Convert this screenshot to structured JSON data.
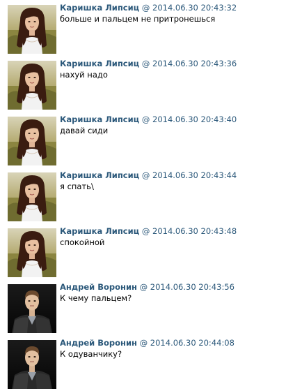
{
  "messages": [
    {
      "author": "Каришка Липсиц",
      "separator": "@",
      "timestamp": "2014.06.30 20:43:32",
      "text": "больше и пальцем не притронешься",
      "avatar": "girl-photo"
    },
    {
      "author": "Каришка Липсиц",
      "separator": "@",
      "timestamp": "2014.06.30 20:43:36",
      "text": "нахуй надо",
      "avatar": "girl-photo"
    },
    {
      "author": "Каришка Липсиц",
      "separator": "@",
      "timestamp": "2014.06.30 20:43:40",
      "text": "давай сиди",
      "avatar": "girl-photo"
    },
    {
      "author": "Каришка Липсиц",
      "separator": "@",
      "timestamp": "2014.06.30 20:43:44",
      "text": "я спать\\",
      "avatar": "girl-photo"
    },
    {
      "author": "Каришка Липсиц",
      "separator": "@",
      "timestamp": "2014.06.30 20:43:48",
      "text": "спокойной",
      "avatar": "girl-photo"
    },
    {
      "author": "Андрей Воронин",
      "separator": "@",
      "timestamp": "2014.06.30 20:43:56",
      "text": "К чему пальцем?",
      "avatar": "boy-photo"
    },
    {
      "author": "Андрей Воронин",
      "separator": "@",
      "timestamp": "2014.06.30 20:44:08",
      "text": "К одуванчику?",
      "avatar": "boy-photo"
    }
  ],
  "colors": {
    "author": "#2b587a",
    "text": "#000000",
    "background": "#ffffff"
  }
}
